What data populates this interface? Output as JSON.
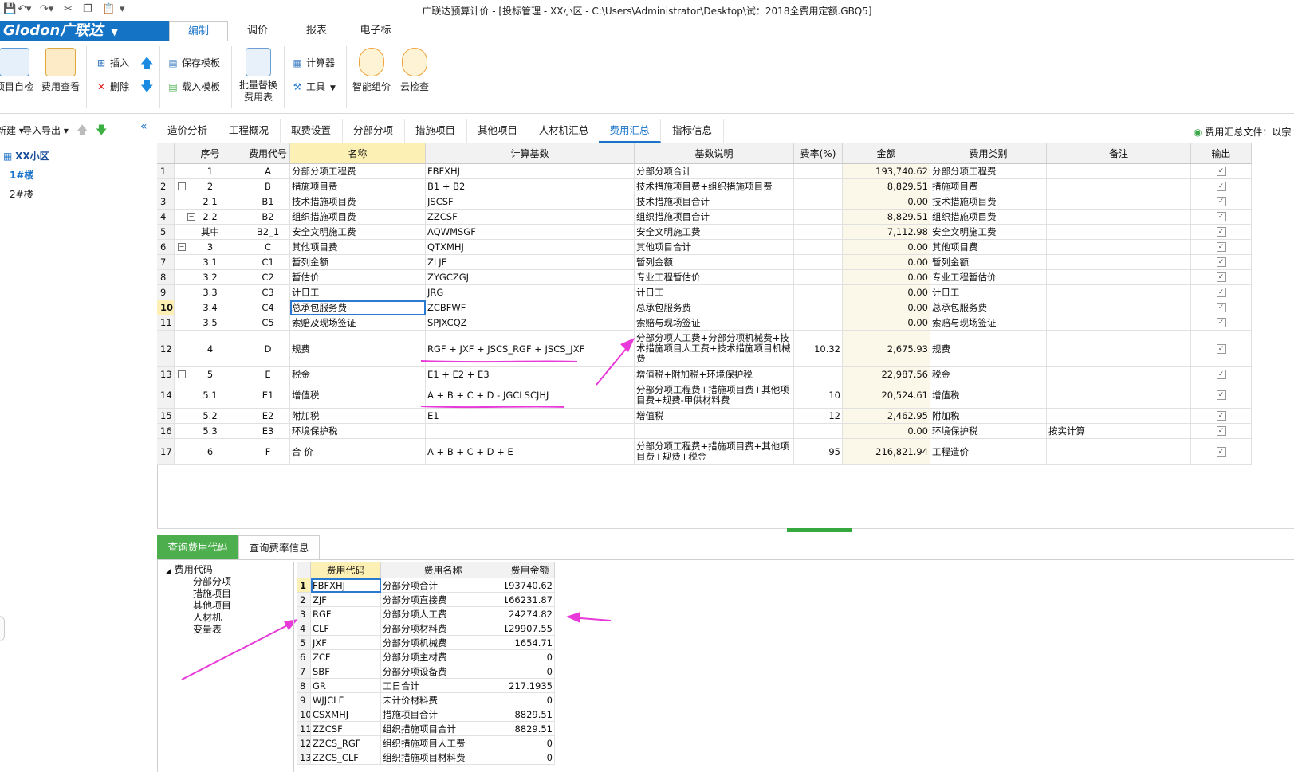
{
  "window": {
    "title": "广联达预算计价 - [投标管理 - XX小区 - C:\\Users\\Administrator\\Desktop\\试：2018全费用定额.GBQ5]"
  },
  "ribbon_tabs": {
    "logo": "Glodon广联达",
    "items": [
      "编制",
      "调价",
      "报表",
      "电子标"
    ],
    "active": "编制"
  },
  "ribbon": {
    "project_check": "项目自检",
    "fee_view": "费用查看",
    "insert": "插入",
    "delete": "删除",
    "save_template": "保存模板",
    "load_template": "载入模板",
    "batch_replace": "批量替换费用表",
    "calculator": "计算器",
    "tools": "工具",
    "smart_price": "智能组价",
    "cloud_check": "云检查"
  },
  "left_panel": {
    "new": "新建",
    "import_export": "导入导出",
    "project": "XX小区",
    "buildings": [
      "1#楼",
      "2#楼"
    ]
  },
  "doc_tabs": {
    "items": [
      "造价分析",
      "工程概况",
      "取费设置",
      "分部分项",
      "措施项目",
      "其他项目",
      "人材机汇总",
      "费用汇总",
      "指标信息"
    ],
    "active": "费用汇总",
    "fee_file_label": "费用汇总文件：以宗"
  },
  "main_grid": {
    "headers": [
      "",
      "序号",
      "费用代号",
      "名称",
      "计算基数",
      "基数说明",
      "费率(%)",
      "金额",
      "费用类别",
      "备注",
      "输出"
    ],
    "rows": [
      {
        "rn": "1",
        "seq": "1",
        "code": "A",
        "name": "分部分项工程费",
        "base": "FBFXHJ",
        "desc": "分部分项合计",
        "rate": "",
        "amount": "193,740.62",
        "cat": "分部分项工程费",
        "note": "",
        "out": "✓"
      },
      {
        "rn": "2",
        "seq": "2",
        "code": "B",
        "name": "措施项目费",
        "base": "B1 + B2",
        "desc": "技术措施项目费+组织措施项目费",
        "rate": "",
        "amount": "8,829.51",
        "cat": "措施项目费",
        "note": "",
        "out": "✓"
      },
      {
        "rn": "3",
        "seq": "2.1",
        "code": "B1",
        "name": "技术措施项目费",
        "base": "JSCSF",
        "desc": "技术措施项目合计",
        "rate": "",
        "amount": "0.00",
        "cat": "技术措施项目费",
        "note": "",
        "out": "✓"
      },
      {
        "rn": "4",
        "seq": "2.2",
        "code": "B2",
        "name": "组织措施项目费",
        "base": "ZZCSF",
        "desc": "组织措施项目合计",
        "rate": "",
        "amount": "8,829.51",
        "cat": "组织措施项目费",
        "note": "",
        "out": "✓"
      },
      {
        "rn": "5",
        "seq": "其中",
        "code": "B2_1",
        "name": "安全文明施工费",
        "base": "AQWMSGF",
        "desc": "安全文明施工费",
        "rate": "",
        "amount": "7,112.98",
        "cat": "安全文明施工费",
        "note": "",
        "out": "✓"
      },
      {
        "rn": "6",
        "seq": "3",
        "code": "C",
        "name": "其他项目费",
        "base": "QTXMHJ",
        "desc": "其他项目合计",
        "rate": "",
        "amount": "0.00",
        "cat": "其他项目费",
        "note": "",
        "out": "✓"
      },
      {
        "rn": "7",
        "seq": "3.1",
        "code": "C1",
        "name": "暂列金额",
        "base": "ZLJE",
        "desc": "暂列金额",
        "rate": "",
        "amount": "0.00",
        "cat": "暂列金额",
        "note": "",
        "out": "✓"
      },
      {
        "rn": "8",
        "seq": "3.2",
        "code": "C2",
        "name": "暂估价",
        "base": "ZYGCZGJ",
        "desc": "专业工程暂估价",
        "rate": "",
        "amount": "0.00",
        "cat": "专业工程暂估价",
        "note": "",
        "out": "✓"
      },
      {
        "rn": "9",
        "seq": "3.3",
        "code": "C3",
        "name": "计日工",
        "base": "JRG",
        "desc": "计日工",
        "rate": "",
        "amount": "0.00",
        "cat": "计日工",
        "note": "",
        "out": "✓"
      },
      {
        "rn": "10",
        "seq": "3.4",
        "code": "C4",
        "name": "总承包服务费",
        "base": "ZCBFWF",
        "desc": "总承包服务费",
        "rate": "",
        "amount": "0.00",
        "cat": "总承包服务费",
        "note": "",
        "out": "✓"
      },
      {
        "rn": "11",
        "seq": "3.5",
        "code": "C5",
        "name": "索赔及现场签证",
        "base": "SPJXCQZ",
        "desc": "索赔与现场签证",
        "rate": "",
        "amount": "0.00",
        "cat": "索赔与现场签证",
        "note": "",
        "out": "✓"
      },
      {
        "rn": "12",
        "seq": "4",
        "code": "D",
        "name": "规费",
        "base": "RGF + JXF + JSCS_RGF + JSCS_JXF",
        "desc": "分部分项人工费+分部分项机械费+技术措施项目人工费+技术措施项目机械费",
        "rate": "10.32",
        "amount": "2,675.93",
        "cat": "规费",
        "note": "",
        "out": "✓"
      },
      {
        "rn": "13",
        "seq": "5",
        "code": "E",
        "name": "税金",
        "base": "E1 + E2 + E3",
        "desc": "增值税+附加税+环境保护税",
        "rate": "",
        "amount": "22,987.56",
        "cat": "税金",
        "note": "",
        "out": "✓"
      },
      {
        "rn": "14",
        "seq": "5.1",
        "code": "E1",
        "name": "增值税",
        "base": "A + B + C + D - JGCLSCJHJ",
        "desc": "分部分项工程费+措施项目费+其他项目费+规费-甲供材料费",
        "rate": "10",
        "amount": "20,524.61",
        "cat": "增值税",
        "note": "",
        "out": "✓"
      },
      {
        "rn": "15",
        "seq": "5.2",
        "code": "E2",
        "name": "附加税",
        "base": "E1",
        "desc": "增值税",
        "rate": "12",
        "amount": "2,462.95",
        "cat": "附加税",
        "note": "",
        "out": "✓"
      },
      {
        "rn": "16",
        "seq": "5.3",
        "code": "E3",
        "name": "环境保护税",
        "base": "",
        "desc": "",
        "rate": "",
        "amount": "0.00",
        "cat": "环境保护税",
        "note": "按实计算",
        "out": "✓"
      },
      {
        "rn": "17",
        "seq": "6",
        "code": "F",
        "name": "合 价",
        "base": "A + B + C + D + E",
        "desc": "分部分项工程费+措施项目费+其他项目费+规费+税金",
        "rate": "95",
        "amount": "216,821.94",
        "cat": "工程造价",
        "note": "",
        "out": "✓"
      }
    ]
  },
  "bottom_tabs": {
    "items": [
      "查询费用代码",
      "查询费率信息"
    ],
    "active": "查询费用代码"
  },
  "code_tree": {
    "root": "费用代码",
    "children": [
      "分部分项",
      "措施项目",
      "其他项目",
      "人材机",
      "变量表"
    ]
  },
  "code_grid": {
    "headers": [
      "",
      "费用代码",
      "费用名称",
      "费用金额"
    ],
    "rows": [
      {
        "rn": "1",
        "code": "FBFXHJ",
        "name": "分部分项合计",
        "amount": "193740.62"
      },
      {
        "rn": "2",
        "code": "ZJF",
        "name": "分部分项直接费",
        "amount": "166231.87"
      },
      {
        "rn": "3",
        "code": "RGF",
        "name": "分部分项人工费",
        "amount": "24274.82"
      },
      {
        "rn": "4",
        "code": "CLF",
        "name": "分部分项材料费",
        "amount": "129907.55"
      },
      {
        "rn": "5",
        "code": "JXF",
        "name": "分部分项机械费",
        "amount": "1654.71"
      },
      {
        "rn": "6",
        "code": "ZCF",
        "name": "分部分项主材费",
        "amount": "0"
      },
      {
        "rn": "7",
        "code": "SBF",
        "name": "分部分项设备费",
        "amount": "0"
      },
      {
        "rn": "8",
        "code": "GR",
        "name": "工日合计",
        "amount": "217.1935"
      },
      {
        "rn": "9",
        "code": "WJJCLF",
        "name": "未计价材料费",
        "amount": "0"
      },
      {
        "rn": "10",
        "code": "CSXMHJ",
        "name": "措施项目合计",
        "amount": "8829.51"
      },
      {
        "rn": "11",
        "code": "ZZCSF",
        "name": "组织措施项目合计",
        "amount": "8829.51"
      },
      {
        "rn": "12",
        "code": "ZZCS_RGF",
        "name": "组织措施项目人工费",
        "amount": "0"
      },
      {
        "rn": "13",
        "code": "ZZCS_CLF",
        "name": "组织措施项目材料费",
        "amount": "0"
      }
    ]
  },
  "colors": {
    "brand": "#1573c6",
    "accent_tab": "#1a73c8",
    "green_tab": "#4cae4c",
    "annotation": "#e83ad8",
    "header_highlight": "#fdf0b4"
  }
}
